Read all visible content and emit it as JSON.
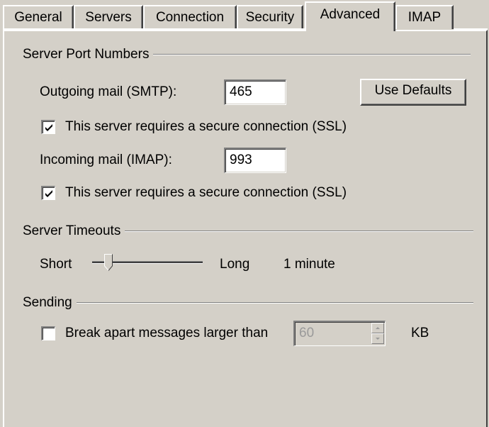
{
  "tabs": [
    {
      "label": "General"
    },
    {
      "label": "Servers"
    },
    {
      "label": "Connection"
    },
    {
      "label": "Security"
    },
    {
      "label": "Advanced",
      "active": true
    },
    {
      "label": "IMAP"
    }
  ],
  "server_ports": {
    "heading": "Server Port Numbers",
    "outgoing_label": "Outgoing mail (SMTP):",
    "outgoing_value": "465",
    "use_defaults_label": "Use Defaults",
    "outgoing_ssl_label": "This server requires a secure connection (SSL)",
    "outgoing_ssl_checked": true,
    "incoming_label": "Incoming mail (IMAP):",
    "incoming_value": "993",
    "incoming_ssl_label": "This server requires a secure connection (SSL)",
    "incoming_ssl_checked": true
  },
  "timeouts": {
    "heading": "Server Timeouts",
    "short_label": "Short",
    "long_label": "Long",
    "value_label": "1 minute",
    "slider_position": 0.15
  },
  "sending": {
    "heading": "Sending",
    "break_apart_label": "Break apart messages larger than",
    "break_apart_checked": false,
    "size_value": "60",
    "unit_label": "KB"
  }
}
